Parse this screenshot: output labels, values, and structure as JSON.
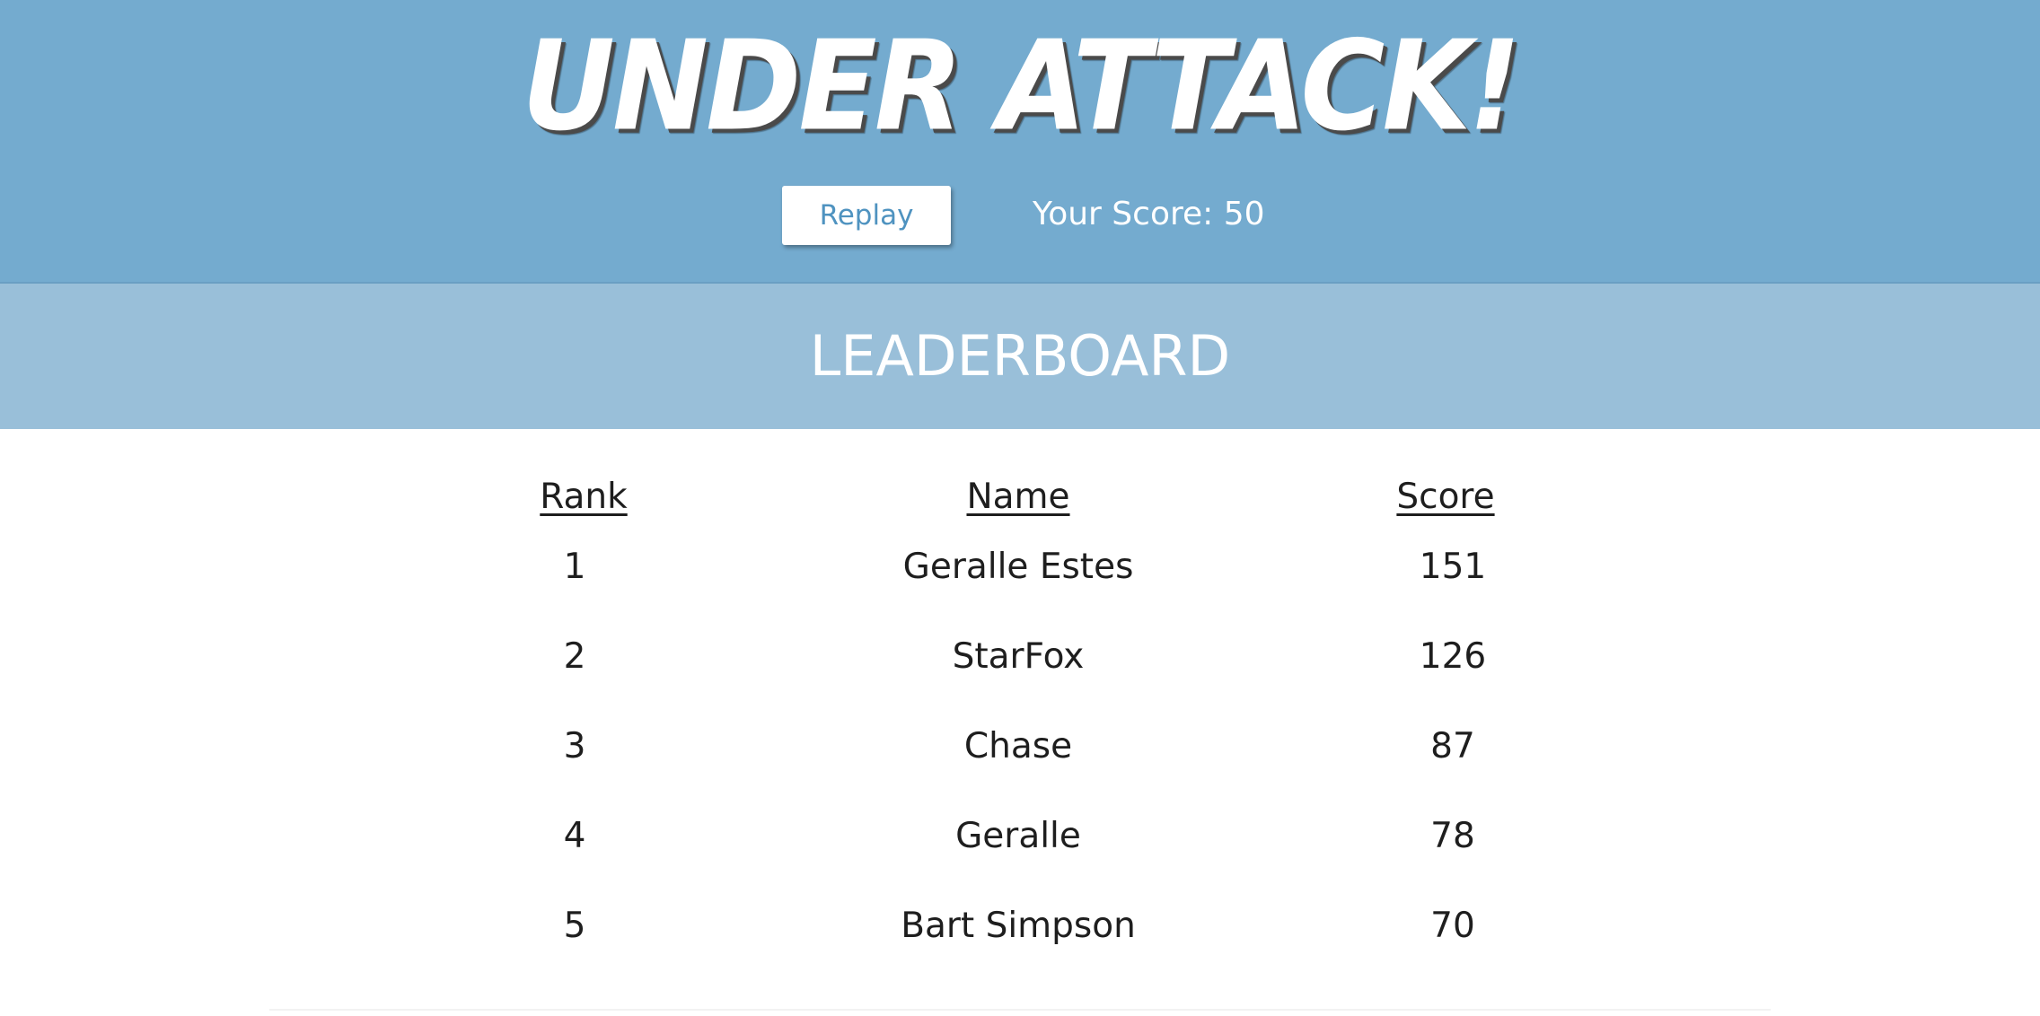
{
  "header": {
    "title": "UNDER ATTACK!",
    "replay_label": "Replay",
    "score_label": "Your Score: 50"
  },
  "leaderboard": {
    "title": "LEADERBOARD",
    "columns": [
      "Rank",
      "Name",
      "Score"
    ],
    "rows": [
      {
        "rank": "1",
        "name": "Geralle Estes",
        "score": "151"
      },
      {
        "rank": "2",
        "name": "StarFox",
        "score": "126"
      },
      {
        "rank": "3",
        "name": "Chase",
        "score": "87"
      },
      {
        "rank": "4",
        "name": "Geralle",
        "score": "78"
      },
      {
        "rank": "5",
        "name": "Bart Simpson",
        "score": "70"
      }
    ]
  },
  "colors": {
    "header_bg": "#74abcf",
    "banner_bg": "#99bfd9",
    "button_text": "#4f93c0",
    "table_text": "#1e1e1e"
  }
}
